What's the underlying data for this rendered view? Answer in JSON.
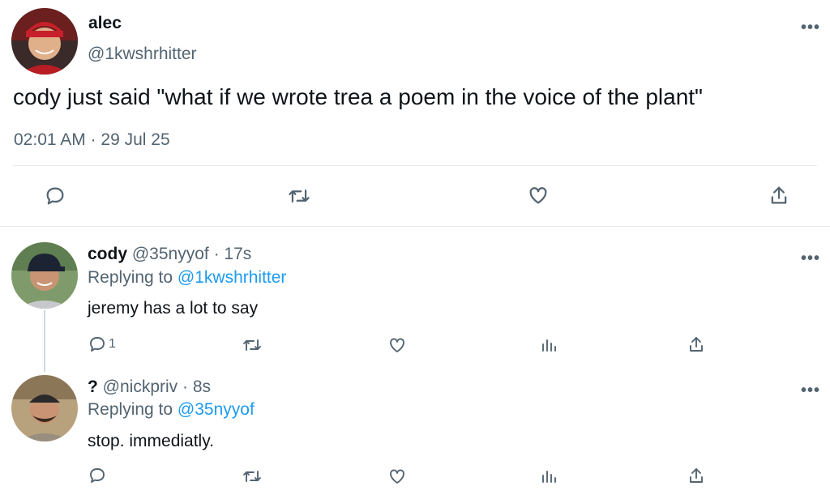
{
  "main_tweet": {
    "display_name": "alec",
    "handle": "@1kwshrhitter",
    "text": "cody just said \"what if we wrote trea a poem in the voice of the plant\"",
    "timestamp": "02:01 AM · 29 Jul 25",
    "more_label": "•••"
  },
  "replies": [
    {
      "display_name": "cody",
      "handle": "@35nyyof",
      "time": "17s",
      "replying_prefix": "Replying to",
      "replying_to": "@1kwshrhitter",
      "text": "jeremy has a lot to say",
      "reply_count": "1",
      "more_label": "•••"
    },
    {
      "display_name": "?",
      "handle": "@nickpriv",
      "time": "8s",
      "replying_prefix": "Replying to",
      "replying_to": "@35nyyof",
      "text": "stop. immediatly.",
      "reply_count": "",
      "more_label": "•••"
    }
  ],
  "colors": {
    "text": "#0f1419",
    "muted": "#536471",
    "link": "#1d9bf0",
    "divider": "#e7e9ea"
  }
}
